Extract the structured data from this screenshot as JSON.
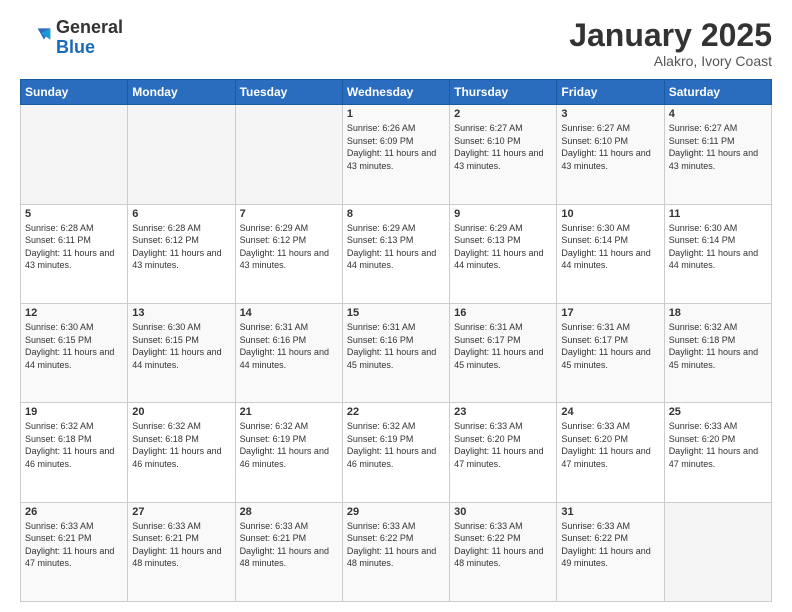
{
  "logo": {
    "general": "General",
    "blue": "Blue"
  },
  "header": {
    "month": "January 2025",
    "location": "Alakro, Ivory Coast"
  },
  "weekdays": [
    "Sunday",
    "Monday",
    "Tuesday",
    "Wednesday",
    "Thursday",
    "Friday",
    "Saturday"
  ],
  "weeks": [
    [
      {
        "day": "",
        "info": ""
      },
      {
        "day": "",
        "info": ""
      },
      {
        "day": "",
        "info": ""
      },
      {
        "day": "1",
        "info": "Sunrise: 6:26 AM\nSunset: 6:09 PM\nDaylight: 11 hours\nand 43 minutes."
      },
      {
        "day": "2",
        "info": "Sunrise: 6:27 AM\nSunset: 6:10 PM\nDaylight: 11 hours\nand 43 minutes."
      },
      {
        "day": "3",
        "info": "Sunrise: 6:27 AM\nSunset: 6:10 PM\nDaylight: 11 hours\nand 43 minutes."
      },
      {
        "day": "4",
        "info": "Sunrise: 6:27 AM\nSunset: 6:11 PM\nDaylight: 11 hours\nand 43 minutes."
      }
    ],
    [
      {
        "day": "5",
        "info": "Sunrise: 6:28 AM\nSunset: 6:11 PM\nDaylight: 11 hours\nand 43 minutes."
      },
      {
        "day": "6",
        "info": "Sunrise: 6:28 AM\nSunset: 6:12 PM\nDaylight: 11 hours\nand 43 minutes."
      },
      {
        "day": "7",
        "info": "Sunrise: 6:29 AM\nSunset: 6:12 PM\nDaylight: 11 hours\nand 43 minutes."
      },
      {
        "day": "8",
        "info": "Sunrise: 6:29 AM\nSunset: 6:13 PM\nDaylight: 11 hours\nand 44 minutes."
      },
      {
        "day": "9",
        "info": "Sunrise: 6:29 AM\nSunset: 6:13 PM\nDaylight: 11 hours\nand 44 minutes."
      },
      {
        "day": "10",
        "info": "Sunrise: 6:30 AM\nSunset: 6:14 PM\nDaylight: 11 hours\nand 44 minutes."
      },
      {
        "day": "11",
        "info": "Sunrise: 6:30 AM\nSunset: 6:14 PM\nDaylight: 11 hours\nand 44 minutes."
      }
    ],
    [
      {
        "day": "12",
        "info": "Sunrise: 6:30 AM\nSunset: 6:15 PM\nDaylight: 11 hours\nand 44 minutes."
      },
      {
        "day": "13",
        "info": "Sunrise: 6:30 AM\nSunset: 6:15 PM\nDaylight: 11 hours\nand 44 minutes."
      },
      {
        "day": "14",
        "info": "Sunrise: 6:31 AM\nSunset: 6:16 PM\nDaylight: 11 hours\nand 44 minutes."
      },
      {
        "day": "15",
        "info": "Sunrise: 6:31 AM\nSunset: 6:16 PM\nDaylight: 11 hours\nand 45 minutes."
      },
      {
        "day": "16",
        "info": "Sunrise: 6:31 AM\nSunset: 6:17 PM\nDaylight: 11 hours\nand 45 minutes."
      },
      {
        "day": "17",
        "info": "Sunrise: 6:31 AM\nSunset: 6:17 PM\nDaylight: 11 hours\nand 45 minutes."
      },
      {
        "day": "18",
        "info": "Sunrise: 6:32 AM\nSunset: 6:18 PM\nDaylight: 11 hours\nand 45 minutes."
      }
    ],
    [
      {
        "day": "19",
        "info": "Sunrise: 6:32 AM\nSunset: 6:18 PM\nDaylight: 11 hours\nand 46 minutes."
      },
      {
        "day": "20",
        "info": "Sunrise: 6:32 AM\nSunset: 6:18 PM\nDaylight: 11 hours\nand 46 minutes."
      },
      {
        "day": "21",
        "info": "Sunrise: 6:32 AM\nSunset: 6:19 PM\nDaylight: 11 hours\nand 46 minutes."
      },
      {
        "day": "22",
        "info": "Sunrise: 6:32 AM\nSunset: 6:19 PM\nDaylight: 11 hours\nand 46 minutes."
      },
      {
        "day": "23",
        "info": "Sunrise: 6:33 AM\nSunset: 6:20 PM\nDaylight: 11 hours\nand 47 minutes."
      },
      {
        "day": "24",
        "info": "Sunrise: 6:33 AM\nSunset: 6:20 PM\nDaylight: 11 hours\nand 47 minutes."
      },
      {
        "day": "25",
        "info": "Sunrise: 6:33 AM\nSunset: 6:20 PM\nDaylight: 11 hours\nand 47 minutes."
      }
    ],
    [
      {
        "day": "26",
        "info": "Sunrise: 6:33 AM\nSunset: 6:21 PM\nDaylight: 11 hours\nand 47 minutes."
      },
      {
        "day": "27",
        "info": "Sunrise: 6:33 AM\nSunset: 6:21 PM\nDaylight: 11 hours\nand 48 minutes."
      },
      {
        "day": "28",
        "info": "Sunrise: 6:33 AM\nSunset: 6:21 PM\nDaylight: 11 hours\nand 48 minutes."
      },
      {
        "day": "29",
        "info": "Sunrise: 6:33 AM\nSunset: 6:22 PM\nDaylight: 11 hours\nand 48 minutes."
      },
      {
        "day": "30",
        "info": "Sunrise: 6:33 AM\nSunset: 6:22 PM\nDaylight: 11 hours\nand 48 minutes."
      },
      {
        "day": "31",
        "info": "Sunrise: 6:33 AM\nSunset: 6:22 PM\nDaylight: 11 hours\nand 49 minutes."
      },
      {
        "day": "",
        "info": ""
      }
    ]
  ]
}
